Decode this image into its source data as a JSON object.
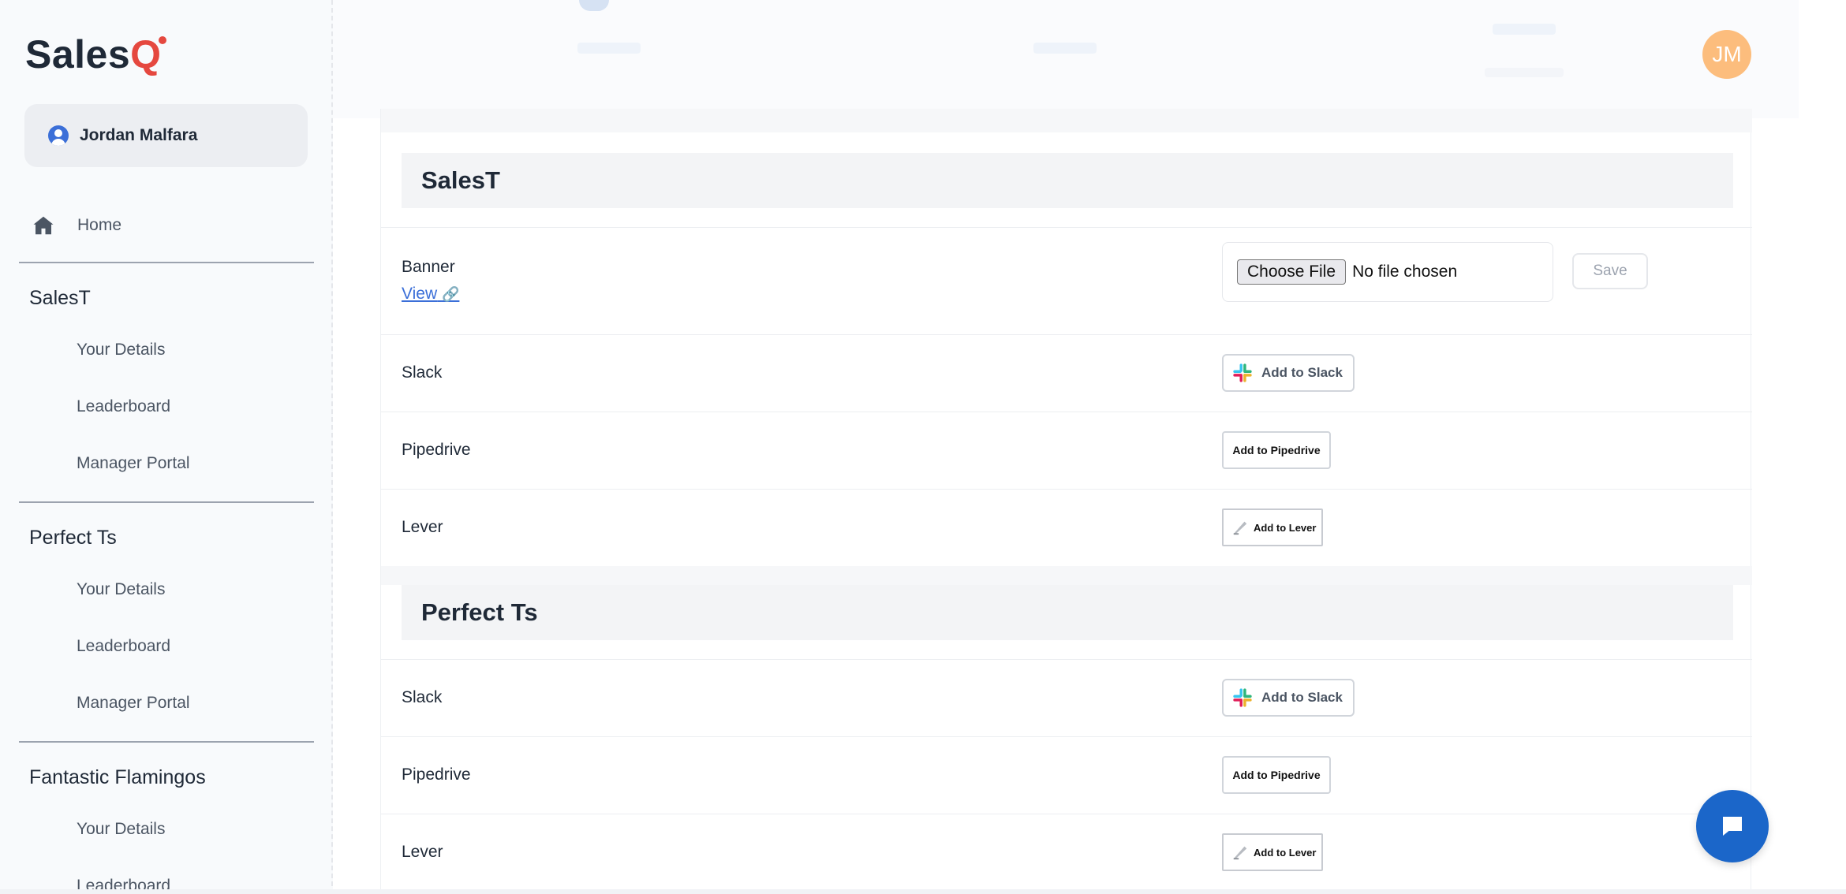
{
  "app": {
    "logo_main": "Sales",
    "logo_q": "Q",
    "user_name": "Jordan Malfara",
    "avatar_initials": "JM"
  },
  "sidebar": {
    "home_label": "Home",
    "groups": [
      {
        "title": "SalesT",
        "items": [
          "Your Details",
          "Leaderboard",
          "Manager Portal"
        ]
      },
      {
        "title": "Perfect Ts",
        "items": [
          "Your Details",
          "Leaderboard",
          "Manager Portal"
        ]
      },
      {
        "title": "Fantastic Flamingos",
        "items": [
          "Your Details",
          "Leaderboard"
        ]
      }
    ]
  },
  "sections": [
    {
      "title": "SalesT",
      "banner": {
        "label": "Banner",
        "view_link": "View",
        "choose_file": "Choose File",
        "no_file": "No file chosen",
        "save": "Save"
      },
      "integrations": [
        {
          "label": "Slack",
          "button": "Add to Slack"
        },
        {
          "label": "Pipedrive",
          "button": "Add to Pipedrive"
        },
        {
          "label": "Lever",
          "button": "Add to Lever"
        }
      ]
    },
    {
      "title": "Perfect Ts",
      "integrations": [
        {
          "label": "Slack",
          "button": "Add to Slack"
        },
        {
          "label": "Pipedrive",
          "button": "Add to Pipedrive"
        },
        {
          "label": "Lever",
          "button": "Add to Lever"
        }
      ]
    }
  ],
  "colors": {
    "brand_red": "#e5483f",
    "link_blue": "#3b6fd8",
    "chat_blue": "#1b66c9",
    "avatar_orange": "#fcbd7d"
  },
  "icons": {
    "home": "home-icon",
    "user": "user-circle-icon",
    "chat": "chat-bubble-icon",
    "link": "link-icon",
    "slack": "slack-logo-icon",
    "lever": "lever-logo-icon"
  }
}
